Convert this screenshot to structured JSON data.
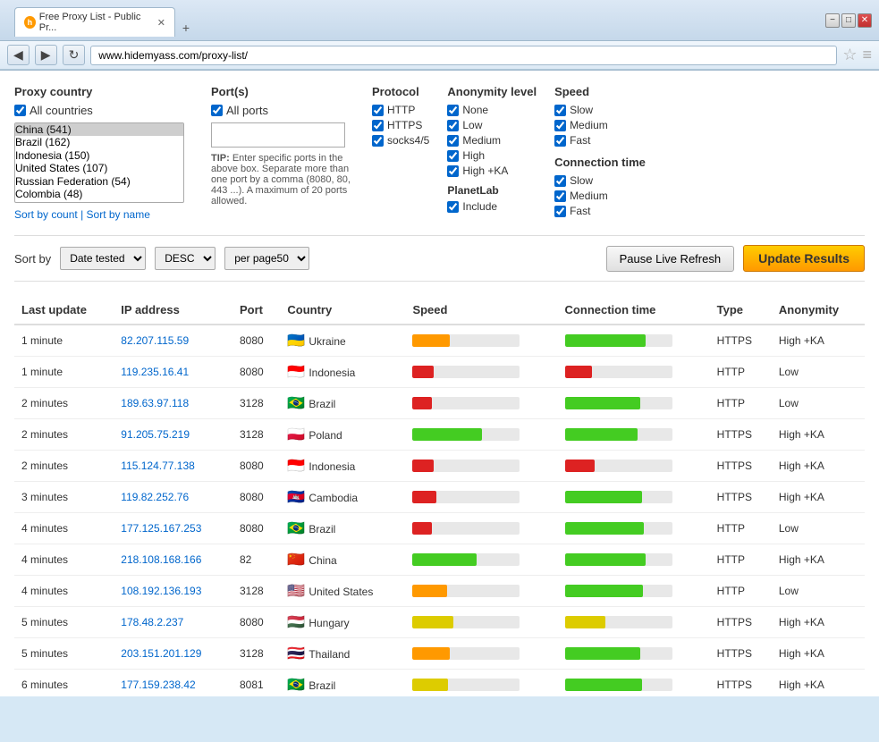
{
  "browser": {
    "title": "Free Proxy List - Public Pr...",
    "tab_label": "Free Proxy List - Public Pr...",
    "address": "www.hidemyass.com/proxy-list/",
    "new_tab_btn": "+",
    "back_btn": "◀",
    "forward_btn": "▶",
    "refresh_btn": "↻"
  },
  "filters": {
    "proxy_country_label": "Proxy country",
    "all_countries_label": "All countries",
    "countries": [
      {
        "name": "China (541)",
        "selected": true
      },
      {
        "name": "Brazil (162)",
        "selected": false
      },
      {
        "name": "Indonesia (150)",
        "selected": false
      },
      {
        "name": "United States (107)",
        "selected": false
      },
      {
        "name": "Russian Federation (54)",
        "selected": false
      },
      {
        "name": "Colombia (48)",
        "selected": false
      }
    ],
    "sort_by_count": "Sort by count",
    "sort_separator": " | ",
    "sort_by_name": "Sort by name",
    "ports_label": "Port(s)",
    "all_ports_label": "All ports",
    "port_input_placeholder": "",
    "tip_text": "TIP: Enter specific ports in the above box. Separate more than one port by a comma (8080, 80, 443 ...). A maximum of 20 ports allowed.",
    "protocol_label": "Protocol",
    "protocols": [
      {
        "label": "HTTP",
        "checked": true
      },
      {
        "label": "HTTPS",
        "checked": true
      },
      {
        "label": "socks4/5",
        "checked": true
      }
    ],
    "anonymity_label": "Anonymity level",
    "anonymity_levels": [
      {
        "label": "None",
        "checked": true
      },
      {
        "label": "Low",
        "checked": true
      },
      {
        "label": "Medium",
        "checked": true
      },
      {
        "label": "High",
        "checked": true
      },
      {
        "label": "High +KA",
        "checked": true
      }
    ],
    "planetlab_label": "PlanetLab",
    "planetlab_include": "Include",
    "planetlab_checked": true,
    "speed_label": "Speed",
    "speed_options": [
      {
        "label": "Slow",
        "checked": true
      },
      {
        "label": "Medium",
        "checked": true
      },
      {
        "label": "Fast",
        "checked": true
      }
    ],
    "connection_time_label": "Connection time",
    "connection_time_options": [
      {
        "label": "Slow",
        "checked": true
      },
      {
        "label": "Medium",
        "checked": true
      },
      {
        "label": "Fast",
        "checked": true
      }
    ]
  },
  "controls": {
    "sort_by_label": "Sort by",
    "sort_field": "Date tested",
    "sort_order": "DESC",
    "per_page": "per page50",
    "pause_btn": "Pause Live Refresh",
    "update_btn": "Update Results"
  },
  "table": {
    "headers": [
      "Last update",
      "IP address",
      "Port",
      "Country",
      "Speed",
      "Connection time",
      "Type",
      "Anonymity"
    ],
    "rows": [
      {
        "last_update": "1 minute",
        "ip": "82.207.115.59",
        "port": "8080",
        "country": "Ukraine",
        "flag": "🇺🇦",
        "speed_pct": 35,
        "speed_color": "bar-orange",
        "conn_pct": 75,
        "conn_color": "bar-green",
        "type": "HTTPS",
        "anonymity": "High +KA"
      },
      {
        "last_update": "1 minute",
        "ip": "119.235.16.41",
        "port": "8080",
        "country": "Indonesia",
        "flag": "🇮🇩",
        "speed_pct": 20,
        "speed_color": "bar-red",
        "conn_pct": 25,
        "conn_color": "bar-red",
        "type": "HTTP",
        "anonymity": "Low"
      },
      {
        "last_update": "2 minutes",
        "ip": "189.63.97.118",
        "port": "3128",
        "country": "Brazil",
        "flag": "🇧🇷",
        "speed_pct": 18,
        "speed_color": "bar-red",
        "conn_pct": 70,
        "conn_color": "bar-green",
        "type": "HTTP",
        "anonymity": "Low"
      },
      {
        "last_update": "2 minutes",
        "ip": "91.205.75.219",
        "port": "3128",
        "country": "Poland",
        "flag": "🇵🇱",
        "speed_pct": 65,
        "speed_color": "bar-green",
        "conn_pct": 68,
        "conn_color": "bar-green",
        "type": "HTTPS",
        "anonymity": "High +KA"
      },
      {
        "last_update": "2 minutes",
        "ip": "115.124.77.138",
        "port": "8080",
        "country": "Indonesia",
        "flag": "🇮🇩",
        "speed_pct": 20,
        "speed_color": "bar-red",
        "conn_pct": 28,
        "conn_color": "bar-red",
        "type": "HTTPS",
        "anonymity": "High +KA"
      },
      {
        "last_update": "3 minutes",
        "ip": "119.82.252.76",
        "port": "8080",
        "country": "Cambodia",
        "flag": "🇰🇭",
        "speed_pct": 22,
        "speed_color": "bar-red",
        "conn_pct": 72,
        "conn_color": "bar-green",
        "type": "HTTPS",
        "anonymity": "High +KA"
      },
      {
        "last_update": "4 minutes",
        "ip": "177.125.167.253",
        "port": "8080",
        "country": "Brazil",
        "flag": "🇧🇷",
        "speed_pct": 18,
        "speed_color": "bar-red",
        "conn_pct": 74,
        "conn_color": "bar-green",
        "type": "HTTP",
        "anonymity": "Low"
      },
      {
        "last_update": "4 minutes",
        "ip": "218.108.168.166",
        "port": "82",
        "country": "China",
        "flag": "🇨🇳",
        "speed_pct": 60,
        "speed_color": "bar-green",
        "conn_pct": 75,
        "conn_color": "bar-green",
        "type": "HTTP",
        "anonymity": "High +KA"
      },
      {
        "last_update": "4 minutes",
        "ip": "108.192.136.193",
        "port": "3128",
        "country": "United States",
        "flag": "🇺🇸",
        "speed_pct": 32,
        "speed_color": "bar-orange",
        "conn_pct": 73,
        "conn_color": "bar-green",
        "type": "HTTP",
        "anonymity": "Low"
      },
      {
        "last_update": "5 minutes",
        "ip": "178.48.2.237",
        "port": "8080",
        "country": "Hungary",
        "flag": "🇭🇺",
        "speed_pct": 38,
        "speed_color": "bar-yellow",
        "conn_pct": 38,
        "conn_color": "bar-yellow",
        "type": "HTTPS",
        "anonymity": "High +KA"
      },
      {
        "last_update": "5 minutes",
        "ip": "203.151.201.129",
        "port": "3128",
        "country": "Thailand",
        "flag": "🇹🇭",
        "speed_pct": 35,
        "speed_color": "bar-orange",
        "conn_pct": 70,
        "conn_color": "bar-green",
        "type": "HTTPS",
        "anonymity": "High +KA"
      },
      {
        "last_update": "6 minutes",
        "ip": "177.159.238.42",
        "port": "8081",
        "country": "Brazil",
        "flag": "🇧🇷",
        "speed_pct": 33,
        "speed_color": "bar-yellow",
        "conn_pct": 72,
        "conn_color": "bar-green",
        "type": "HTTPS",
        "anonymity": "High +KA"
      }
    ]
  }
}
